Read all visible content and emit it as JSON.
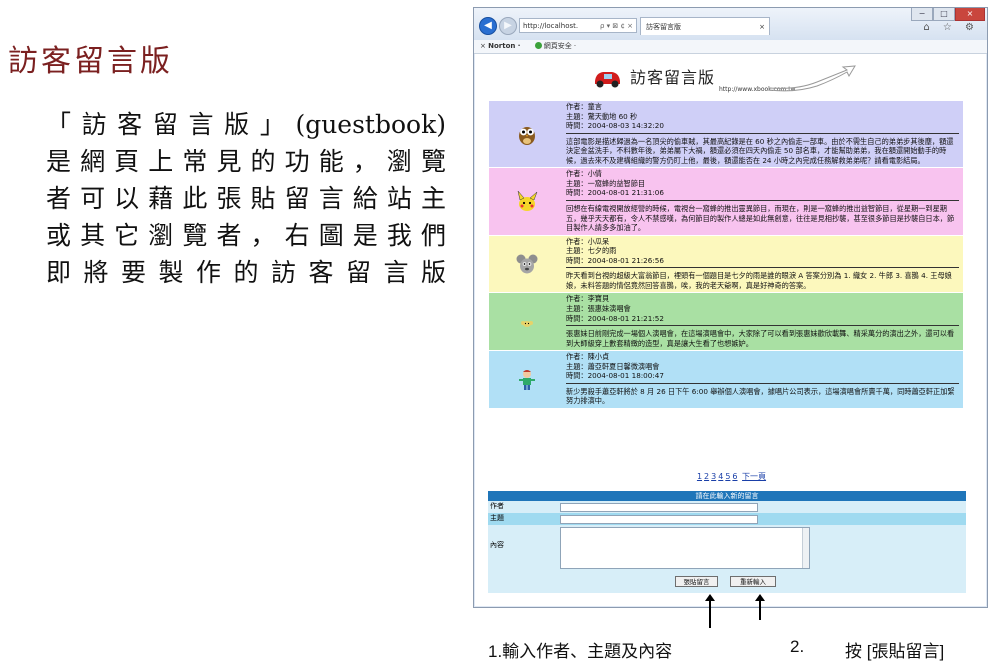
{
  "slide": {
    "title": "訪客留言版",
    "desc_lines": [
      "「訪客留言版」(guestbook)",
      "是網頁上常見的功能，瀏覽",
      "者可以藉此張貼留言給站主",
      "或其它瀏覽者，右圖是我們",
      "即將要製作的訪客留言版"
    ],
    "caption1": "1.輸入作者、主題及內容",
    "caption2": "2.",
    "caption3": "按 [張貼留言]"
  },
  "browser": {
    "address": "http://localhost.",
    "address_icons": "ρ ▾ ⊠ ¢ ×",
    "tab_title": "訪客留言版",
    "toolbar_norton": "Norton ·",
    "toolbar_safe": "網頁安全 ·",
    "toolbar_close": "×",
    "tools_icons": "⌂ ☆ ⚙",
    "win_buttons": {
      "min": "−",
      "max": "□",
      "close": "×"
    }
  },
  "page": {
    "title": "訪客留言版",
    "url": "http://www.xbook.com.tw"
  },
  "entries": [
    {
      "author": "作者：童言",
      "subject": "主題：驚天動地 60 秒",
      "time": "時間：2004-08-03 14:32:20",
      "body": "這部電影是描述歸過為一名頂尖的偷車賊，其最高紀錄是在 60 秒之內偷走一部車。由於不需生自己的弟弟步其後塵，額還決定金盆洗手，不料數年後，弟弟屬下大禍，額還必須在四天內偷走 50 部名車，才能幫助弟弟，我在額還開始動手的時候，過去來不及建構組織的警方仍盯上他，最後，額還能否在 24 小時之內完成任務解救弟弟呢？請看電影結局。",
      "avatar": "owl-icon",
      "color": "#cfcff7"
    },
    {
      "author": "作者：小倩",
      "subject": "主題：一窩蜂的益智節目",
      "time": "時間：2004-08-01 21:31:06",
      "body": "回想在有線電視開放經營的時候，電視台一窩蜂的推出靈異節目，而現在，則是一窩蜂的推出益智節目，從星期一到星期五，幾乎天天都有，令人不禁感嘆，為何節目的製作人總是如此無創意，往往是見相抄襲，甚至很多節目是抄襲自日本，節目製作人請多多加油了。",
      "avatar": "pikachu-icon",
      "color": "#f8c3ef"
    },
    {
      "author": "作者：小瓜呆",
      "subject": "主題：七夕的雨",
      "time": "時間：2004-08-01 21:26:56",
      "body": "昨天看到台視的超級大富翁節目，裡頭有一個題目是七夕的雨是誰的眼淚 A 答案分別為 1. 織女 2. 牛郎 3. 喜鵲 4. 王母娘娘，未料答題的情侶竟然回答喜鵲，唉，我的老天爺啊，真是好神奇的答案。",
      "avatar": "mouse-icon",
      "color": "#fcf8bd"
    },
    {
      "author": "作者：李寶貝",
      "subject": "主題：張惠妹演唱會",
      "time": "時間：2004-08-01 21:21:52",
      "body": "張惠妹日前剛完成一場個人演唱會，在這場演唱會中，大家除了可以看到張惠妹歡欣載舞、精采萬分的演出之外，還可以看到大師級穿上數套精緻的造型，真是讓大生看了也想嫉妒。",
      "avatar": "bug-icon",
      "color": "#a9e0a3"
    },
    {
      "author": "作者：陳小貞",
      "subject": "主題：蕭亞軒夏日馨微演唱會",
      "time": "時間：2004-08-01 18:00:47",
      "body": "新少男殺手蕭亞軒將於 8 月 26 日下午 6:00 舉辦個人演唱會，據唱片公司表示，這場演唱會所賣千萬，同時蕭亞軒正加緊努力排演中。",
      "avatar": "kid-icon",
      "color": "#b1e0f6"
    }
  ],
  "pager": {
    "pages": [
      "1",
      "2",
      "3",
      "4",
      "5",
      "6"
    ],
    "next": "下一頁"
  },
  "form": {
    "header": "請在此輸入新的留言",
    "author_label": "作者",
    "subject_label": "主題",
    "content_label": "內容",
    "submit": "張貼留言",
    "reset": "重新輸入"
  }
}
